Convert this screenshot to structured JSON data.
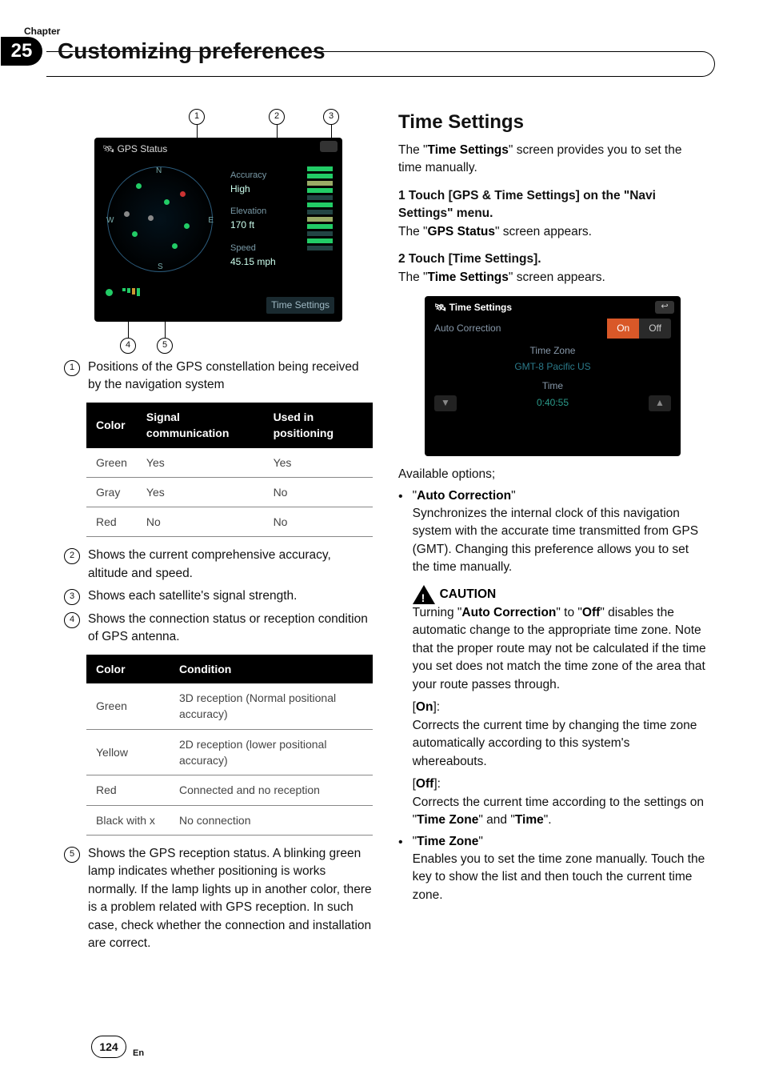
{
  "chapter": {
    "label": "Chapter",
    "number": "25",
    "title": "Customizing preferences"
  },
  "gps_figure": {
    "title": "GPS Status",
    "accuracy_label": "Accuracy",
    "accuracy_value": "High",
    "elevation_label": "Elevation",
    "elevation_value": "170 ft",
    "speed_label": "Speed",
    "speed_value": "45.15 mph",
    "time_settings_btn": "Time Settings",
    "compass": {
      "n": "N",
      "e": "E",
      "s": "S",
      "w": "W"
    }
  },
  "callouts": {
    "c1": "Positions of the GPS constellation being received by the navigation system",
    "c2": "Shows the current comprehensive accuracy, altitude and speed.",
    "c3": "Shows each satellite's signal strength.",
    "c4": "Shows the connection status or reception condition of GPS antenna.",
    "c5": "Shows the GPS reception status. A blinking green lamp indicates whether positioning is works normally. If the lamp lights up in another color, there is a problem related with GPS reception. In such case, check whether the connection and installation are correct."
  },
  "table1": {
    "headers": {
      "color": "Color",
      "signal": "Signal communication",
      "used": "Used in positioning"
    },
    "rows": [
      {
        "color": "Green",
        "signal": "Yes",
        "used": "Yes"
      },
      {
        "color": "Gray",
        "signal": "Yes",
        "used": "No"
      },
      {
        "color": "Red",
        "signal": "No",
        "used": "No"
      }
    ]
  },
  "table2": {
    "headers": {
      "color": "Color",
      "condition": "Condition"
    },
    "rows": [
      {
        "color": "Green",
        "condition": "3D reception (Normal positional accuracy)"
      },
      {
        "color": "Yellow",
        "condition": "2D reception (lower positional accuracy)"
      },
      {
        "color": "Red",
        "condition": "Connected and no reception"
      },
      {
        "color": "Black with x",
        "condition": "No connection"
      }
    ]
  },
  "section2": {
    "heading": "Time Settings",
    "intro_pre": "The \"",
    "intro_b": "Time Settings",
    "intro_post": "\" screen provides you to set the time manually.",
    "step1_head": "1    Touch [GPS & Time Settings] on the \"Navi Settings\" menu.",
    "step1_body_pre": "The \"",
    "step1_body_b": "GPS Status",
    "step1_body_post": "\" screen appears.",
    "step2_head": "2    Touch [Time Settings].",
    "step2_body_pre": "The \"",
    "step2_body_b": "Time Settings",
    "step2_body_post": "\" screen appears."
  },
  "ts_figure": {
    "title": "Time Settings",
    "auto_label": "Auto Correction",
    "on": "On",
    "off": "Off",
    "tz_label": "Time Zone",
    "tz_value": "GMT-8 Pacific US",
    "time_label": "Time",
    "time_value": "0:40:55"
  },
  "options": {
    "intro": "Available options;",
    "auto_label": "Auto Correction",
    "auto_body": "Synchronizes the internal clock of this navigation system with the accurate time transmitted from GPS (GMT). Changing this preference allows you to set the time manually.",
    "caution_label": "CAUTION",
    "caution_body_pre": "Turning \"",
    "caution_b1": "Auto Correction",
    "caution_mid": "\" to \"",
    "caution_b2": "Off",
    "caution_body_post": "\" disables the automatic change to the appropriate time zone. Note that the proper route may not be calculated if the time you set does not match the time zone of the area that your route passes through.",
    "on_label": "On",
    "on_body": "Corrects the current time by changing the time zone automatically according to this system's whereabouts.",
    "off_label": "Off",
    "off_body_pre": "Corrects the current time according to the settings on \"",
    "off_b1": "Time Zone",
    "off_mid": "\" and \"",
    "off_b2": "Time",
    "off_body_post": "\".",
    "tz_label": "Time Zone",
    "tz_body": "Enables you to set the time zone manually. Touch the key to show the list and then touch the current time zone."
  },
  "footer": {
    "page": "124",
    "lang": "En"
  }
}
